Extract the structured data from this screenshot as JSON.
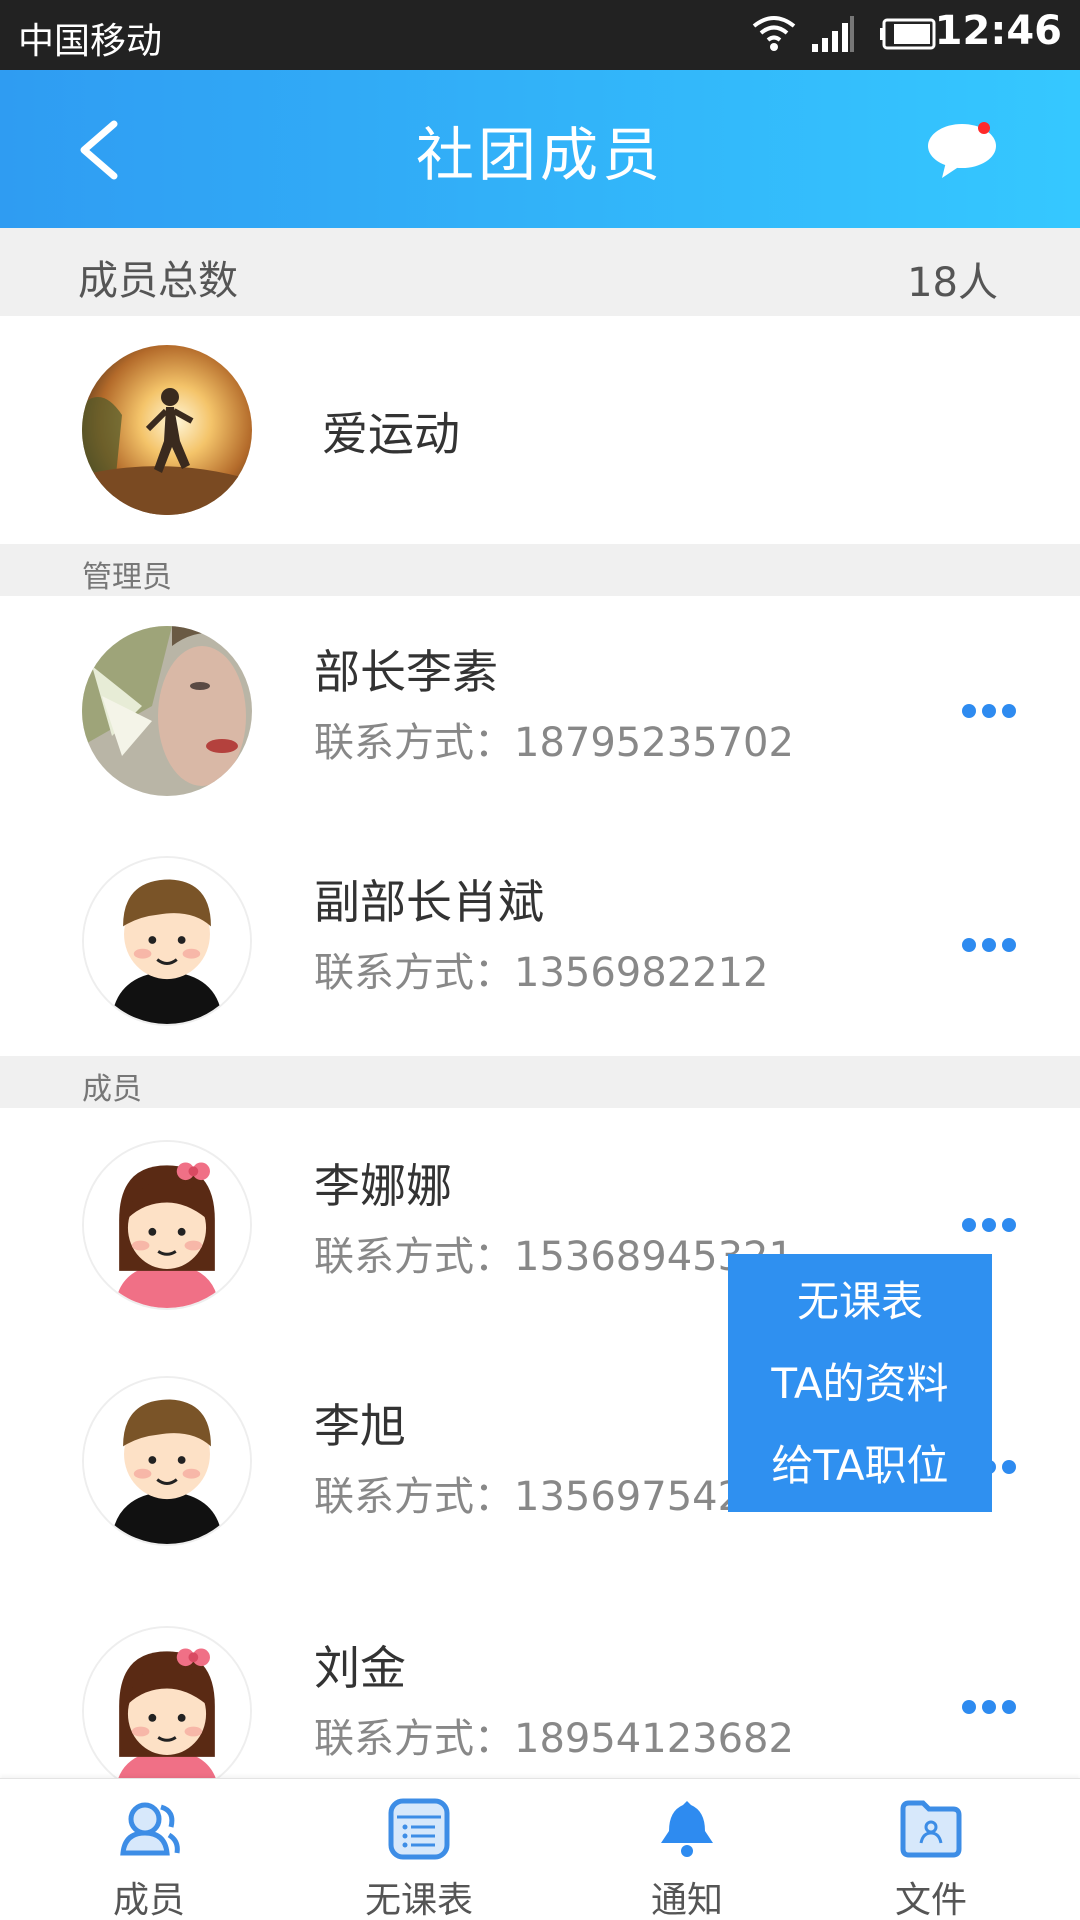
{
  "status_bar": {
    "carrier": "中国移动",
    "time": "12:46"
  },
  "header": {
    "title": "社团成员"
  },
  "summary": {
    "label": "成员总数",
    "count": "18人"
  },
  "club": {
    "name": "爱运动"
  },
  "sections": {
    "admins": "管理员",
    "members": "成员"
  },
  "admins": [
    {
      "name": "部长李素",
      "contact": "联系方式：18795235702"
    },
    {
      "name": "副部长肖斌",
      "contact": "联系方式：1356982212"
    }
  ],
  "members": [
    {
      "name": "李娜娜",
      "contact": "联系方式：15368945321"
    },
    {
      "name": "李旭",
      "contact": "联系方式：13569754251"
    },
    {
      "name": "刘金",
      "contact": "联系方式：18954123682"
    }
  ],
  "popup_menu": {
    "items": [
      "无课表",
      "TA的资料",
      "给TA职位"
    ]
  },
  "bottom_nav": {
    "tabs": [
      "成员",
      "无课表",
      "通知",
      "文件"
    ],
    "active": "成员"
  },
  "colors": {
    "accent": "#2e8bf0",
    "header_start": "#2f9cf2",
    "header_end": "#35c8ff",
    "badge": "#ff2a2a"
  }
}
